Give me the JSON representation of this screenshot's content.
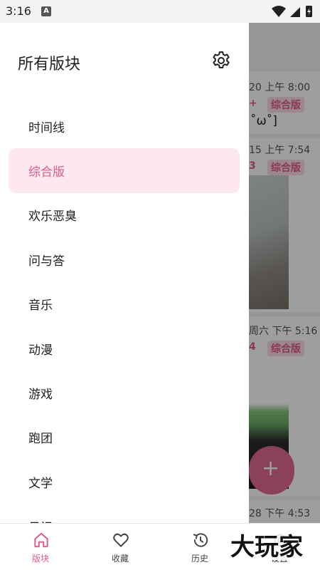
{
  "status": {
    "time": "3:16",
    "notification_letter": "A"
  },
  "drawer": {
    "title": "所有版块",
    "items": [
      {
        "label": "时间线",
        "active": false
      },
      {
        "label": "综合版",
        "active": true
      },
      {
        "label": "欢乐恶臭",
        "active": false
      },
      {
        "label": "问与答",
        "active": false
      },
      {
        "label": "音乐",
        "active": false
      },
      {
        "label": "动漫",
        "active": false
      },
      {
        "label": "游戏",
        "active": false
      },
      {
        "label": "跑团",
        "active": false
      },
      {
        "label": "文学",
        "active": false
      },
      {
        "label": "日记",
        "active": false
      }
    ]
  },
  "feed": {
    "cards": [
      {
        "time": "20 上午 8:00",
        "count": "+",
        "tag": "综合版",
        "text": "˚ω˚]"
      },
      {
        "time": "15 上午 7:54",
        "count": "3",
        "tag": "综合版"
      },
      {
        "time": "周六 下午 5:16",
        "count": "4",
        "tag": "综合版"
      },
      {
        "time": "28 下午 4:53"
      }
    ]
  },
  "bottom_nav": [
    {
      "label": "版块",
      "icon": "home-icon",
      "active": true
    },
    {
      "label": "收藏",
      "icon": "heart-icon",
      "active": false
    },
    {
      "label": "历史",
      "icon": "history-icon",
      "active": false
    },
    {
      "label": "设置",
      "icon": "settings-icon",
      "active": false
    }
  ],
  "watermark": {
    "text": "大玩家"
  },
  "colors": {
    "accent": "#e05a85",
    "accent_light": "#fde8ee",
    "fab": "#e06a90"
  }
}
